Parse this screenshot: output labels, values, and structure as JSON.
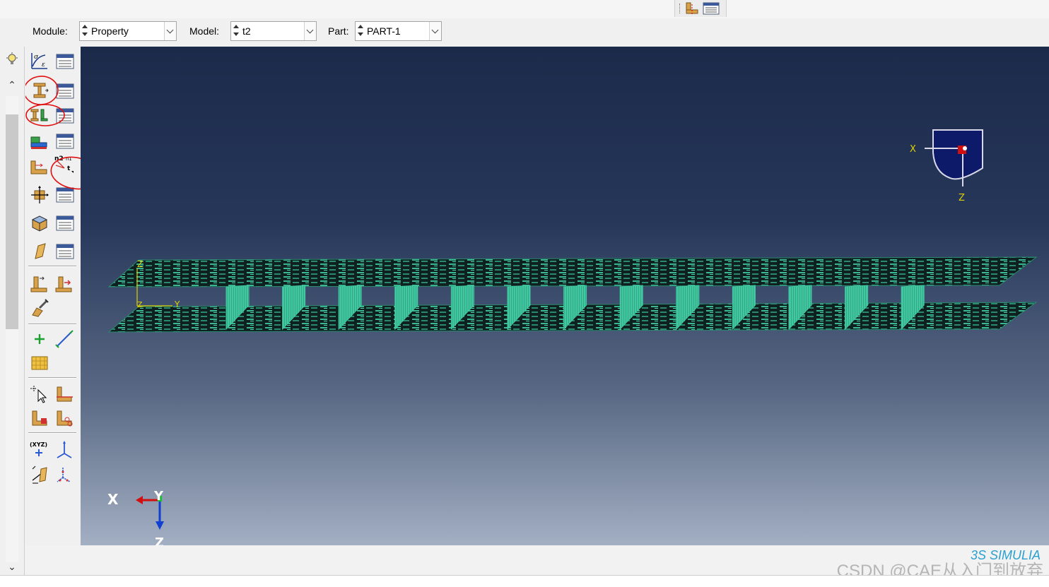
{
  "top_toolbar": {
    "icons": [
      "part-geometry-icon",
      "manager-list-icon"
    ]
  },
  "context_bar": {
    "module_label": "Module:",
    "module_value": "Property",
    "model_label": "Model:",
    "model_value": "t2",
    "part_label": "Part:",
    "part_value": "PART-1"
  },
  "toolbox": {
    "icons": [
      "create-material-icon",
      "material-manager-icon",
      "create-section-icon",
      "section-manager-icon",
      "create-profile-icon",
      "profile-manager-icon",
      "assign-section-icon",
      "section-assignment-manager-icon",
      "assign-orientation-icon",
      "assign-normal-tangent-icon",
      "special-inertia-icon",
      "inertia-manager-icon",
      "create-composite-layup-icon",
      "layup-manager-icon",
      "skin-icon",
      "skin-manager-icon",
      "assign-beam-orientation-icon",
      "assign-rebar-icon",
      "create-stringer-icon",
      "create-datum-point-icon",
      "create-datum-axis-icon",
      "create-datum-plane-icon",
      "query-icon",
      "partition-icon",
      "repair-icon",
      "remove-face-icon",
      "create-datum-csys-icon",
      "create-display-group-icon",
      "rotate-icon",
      "transform-csys-icon"
    ],
    "annotated_tools": [
      "create-section-icon",
      "create-profile-icon",
      "assign-normal-tangent-icon"
    ],
    "annotation_color": "#e01010"
  },
  "viewport": {
    "background_top": "#1c2a4a",
    "background_bottom": "#a3afc3",
    "mesh_color": "#40c8a0",
    "view_cube": {
      "axis_x": "X",
      "axis_z": "Z"
    },
    "local_csys": {
      "axis_z": "Z",
      "axis_y": "Y"
    },
    "global_triad": {
      "x": "X",
      "y": "Y",
      "z": "Z"
    }
  },
  "watermark": "CSDN @CAE从入门到放弃",
  "brand": "3S SIMULIA"
}
